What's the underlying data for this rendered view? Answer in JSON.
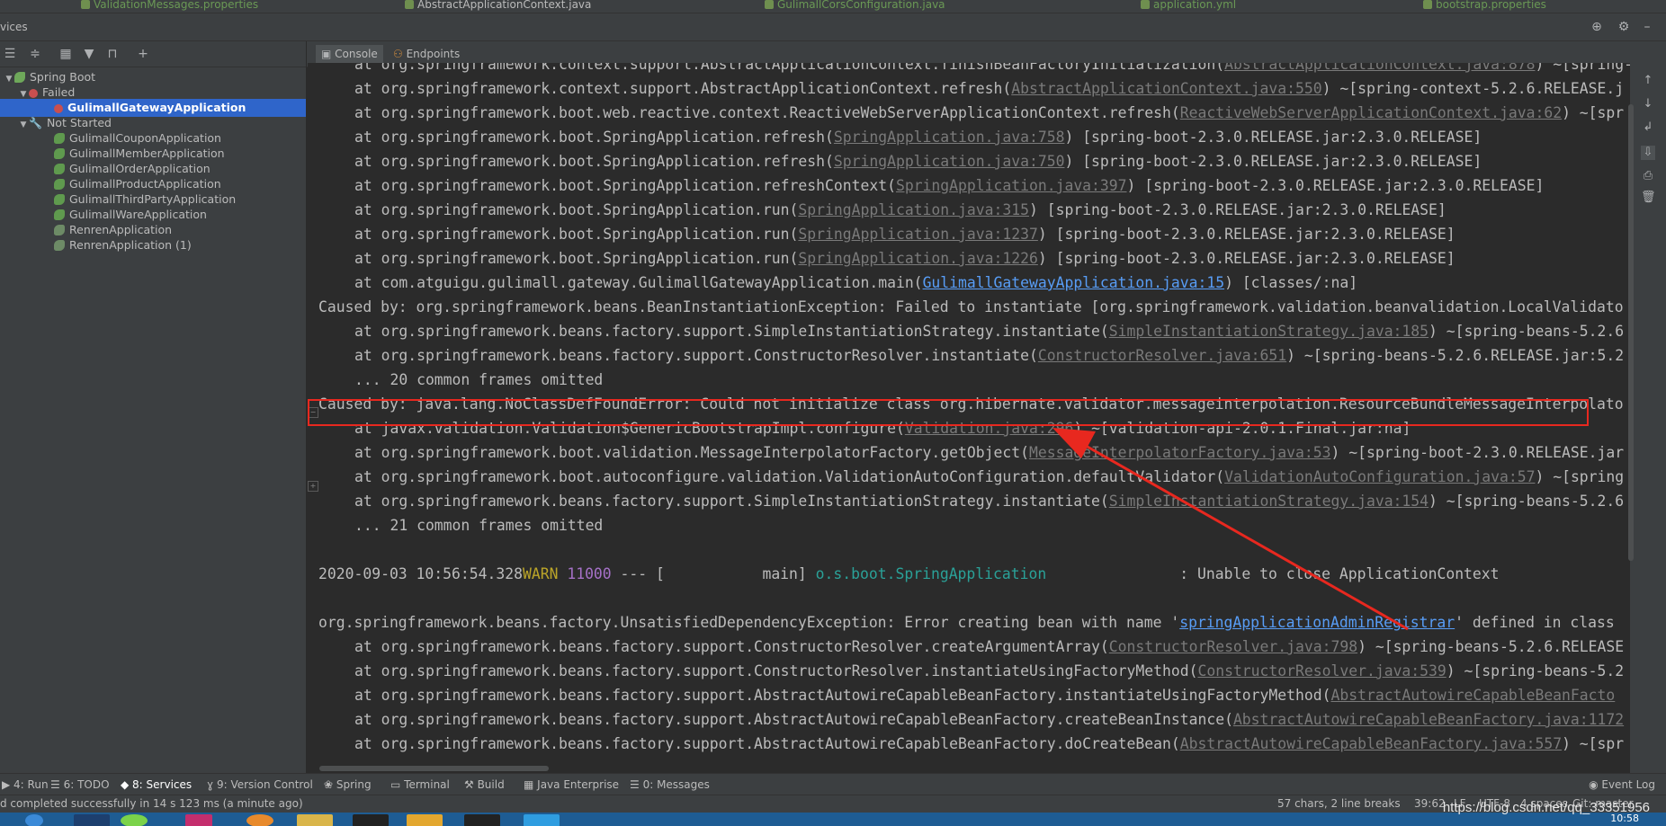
{
  "editor_tabs": [
    {
      "label": "ValidationMessages.properties",
      "selected": false
    },
    {
      "label": "AbstractApplicationContext.java",
      "selected": true
    },
    {
      "label": "GulimallCorsConfiguration.java",
      "selected": false
    },
    {
      "label": "application.yml",
      "selected": false
    },
    {
      "label": "bootstrap.properties",
      "selected": false
    }
  ],
  "services": {
    "title": "vices",
    "tree": {
      "root": "Spring Boot",
      "failed_group": "Failed",
      "failed_items": [
        "GulimallGatewayApplication"
      ],
      "not_started_group": "Not Started",
      "not_started_items": [
        "GulimallCouponApplication",
        "GulimallMemberApplication",
        "GulimallOrderApplication",
        "GulimallProductApplication",
        "GulimallThirdPartyApplication",
        "GulimallWareApplication",
        "RenrenApplication",
        "RenrenApplication (1)"
      ]
    }
  },
  "console_tabs": {
    "console": "Console",
    "endpoints": "Endpoints"
  },
  "console_lines": [
    {
      "indent": true,
      "pre": "at org.springframework.context.support.AbstractApplicationContext.finishBeanFactoryInitialization(",
      "link": "AbstractApplicationContext.java:878",
      "post": ") ~[spring-"
    },
    {
      "indent": true,
      "pre": "at org.springframework.context.support.AbstractApplicationContext.refresh(",
      "link": "AbstractApplicationContext.java:550",
      "post": ") ~[spring-context-5.2.6.RELEASE.j"
    },
    {
      "indent": true,
      "pre": "at org.springframework.boot.web.reactive.context.ReactiveWebServerApplicationContext.refresh(",
      "link": "ReactiveWebServerApplicationContext.java:62",
      "post": ") ~[spr"
    },
    {
      "indent": true,
      "pre": "at org.springframework.boot.SpringApplication.refresh(",
      "link": "SpringApplication.java:758",
      "post": ") [spring-boot-2.3.0.RELEASE.jar:2.3.0.RELEASE]"
    },
    {
      "indent": true,
      "pre": "at org.springframework.boot.SpringApplication.refresh(",
      "link": "SpringApplication.java:750",
      "post": ") [spring-boot-2.3.0.RELEASE.jar:2.3.0.RELEASE]"
    },
    {
      "indent": true,
      "pre": "at org.springframework.boot.SpringApplication.refreshContext(",
      "link": "SpringApplication.java:397",
      "post": ") [spring-boot-2.3.0.RELEASE.jar:2.3.0.RELEASE]"
    },
    {
      "indent": true,
      "pre": "at org.springframework.boot.SpringApplication.run(",
      "link": "SpringApplication.java:315",
      "post": ") [spring-boot-2.3.0.RELEASE.jar:2.3.0.RELEASE]"
    },
    {
      "indent": true,
      "pre": "at org.springframework.boot.SpringApplication.run(",
      "link": "SpringApplication.java:1237",
      "post": ") [spring-boot-2.3.0.RELEASE.jar:2.3.0.RELEASE]"
    },
    {
      "indent": true,
      "pre": "at org.springframework.boot.SpringApplication.run(",
      "link": "SpringApplication.java:1226",
      "post": ") [spring-boot-2.3.0.RELEASE.jar:2.3.0.RELEASE]"
    },
    {
      "indent": true,
      "pre": "at com.atguigu.gulimall.gateway.GulimallGatewayApplication.main(",
      "link": "GulimallGatewayApplication.java:15",
      "linkBlue": true,
      "post": ") [classes/:na]"
    },
    {
      "indent": false,
      "pre": "Caused by: org.springframework.beans.BeanInstantiationException: Failed to instantiate [org.springframework.validation.beanvalidation.LocalValidato",
      "link": "",
      "post": ""
    },
    {
      "indent": true,
      "pre": "at org.springframework.beans.factory.support.SimpleInstantiationStrategy.instantiate(",
      "link": "SimpleInstantiationStrategy.java:185",
      "post": ") ~[spring-beans-5.2.6"
    },
    {
      "indent": true,
      "pre": "at org.springframework.beans.factory.support.ConstructorResolver.instantiate(",
      "link": "ConstructorResolver.java:651",
      "post": ") ~[spring-beans-5.2.6.RELEASE.jar:5.2"
    },
    {
      "indent": true,
      "pre": "... 20 common frames omitted",
      "link": "",
      "post": ""
    },
    {
      "indent": false,
      "pre": "Caused by: java.lang.NoClassDefFoundError: Could not initialize class org.hibernate.validator.messageinterpolation.ResourceBundleMessageInterpolato",
      "link": "",
      "post": ""
    },
    {
      "indent": true,
      "pre": "at javax.validation.Validation$GenericBootstrapImpl.configure(",
      "link": "Validation.java:296",
      "post": ") ~[validation-api-2.0.1.Final.jar:na]"
    },
    {
      "indent": true,
      "pre": "at org.springframework.boot.validation.MessageInterpolatorFactory.getObject(",
      "link": "MessageInterpolatorFactory.java:53",
      "post": ") ~[spring-boot-2.3.0.RELEASE.jar"
    },
    {
      "indent": true,
      "pre": "at org.springframework.boot.autoconfigure.validation.ValidationAutoConfiguration.defaultValidator(",
      "link": "ValidationAutoConfiguration.java:57",
      "post": ") ~[spring"
    },
    {
      "indent": true,
      "pre": "at org.springframework.beans.factory.support.SimpleInstantiationStrategy.instantiate(",
      "link": "SimpleInstantiationStrategy.java:154",
      "post": ") ~[spring-beans-5.2.6"
    },
    {
      "indent": true,
      "pre": "... 21 common frames omitted",
      "link": "",
      "post": ""
    }
  ],
  "warn_line": {
    "timestamp": "2020-09-03 10:56:54.328",
    "level": "WARN",
    "pid": "11000",
    "sep": "---",
    "thread": "[           main]",
    "logger": "o.s.boot.SpringApplication",
    "message": ": Unable to close ApplicationContext"
  },
  "exception_line": {
    "pre": "org.springframework.beans.factory.UnsatisfiedDependencyException: Error creating bean with name '",
    "link": "springApplicationAdminRegistrar",
    "post": "' defined in class"
  },
  "console_lines2": [
    {
      "pre": "at org.springframework.beans.factory.support.ConstructorResolver.createArgumentArray(",
      "link": "ConstructorResolver.java:798",
      "post": ") ~[spring-beans-5.2.6.RELEASE"
    },
    {
      "pre": "at org.springframework.beans.factory.support.ConstructorResolver.instantiateUsingFactoryMethod(",
      "link": "ConstructorResolver.java:539",
      "post": ") ~[spring-beans-5.2"
    },
    {
      "pre": "at org.springframework.beans.factory.support.AbstractAutowireCapableBeanFactory.instantiateUsingFactoryMethod(",
      "link": "AbstractAutowireCapableBeanFacto",
      "post": ""
    },
    {
      "pre": "at org.springframework.beans.factory.support.AbstractAutowireCapableBeanFactory.createBeanInstance(",
      "link": "AbstractAutowireCapableBeanFactory.java:1172",
      "post": ""
    },
    {
      "pre": "at org.springframework.beans.factory.support.AbstractAutowireCapableBeanFactory.doCreateBean(",
      "link": "AbstractAutowireCapableBeanFactory.java:557",
      "post": ") ~[spr"
    }
  ],
  "tool_windows": [
    {
      "label": "4: Run"
    },
    {
      "label": "6: TODO"
    },
    {
      "label": "8: Services",
      "active": true
    },
    {
      "label": "9: Version Control"
    },
    {
      "label": "Spring"
    },
    {
      "label": "Terminal"
    },
    {
      "label": "Build"
    },
    {
      "label": "Java Enterprise"
    },
    {
      "label": "0: Messages"
    }
  ],
  "event_log": "Event Log",
  "status": {
    "message": "d completed successfully in 14 s 123 ms (a minute ago)",
    "chars": "57 chars, 2 line breaks",
    "position": "39:62",
    "line_sep": "LF",
    "encoding": "UTF-8",
    "indent": "4 spaces",
    "git": "Git: master"
  },
  "clock": "10:58",
  "watermark": "https://blog.csdn.net/qq_33351956",
  "colors": {
    "highlight": "#e8281f",
    "selection": "#2f65ca",
    "accent_link": "#589df6"
  }
}
